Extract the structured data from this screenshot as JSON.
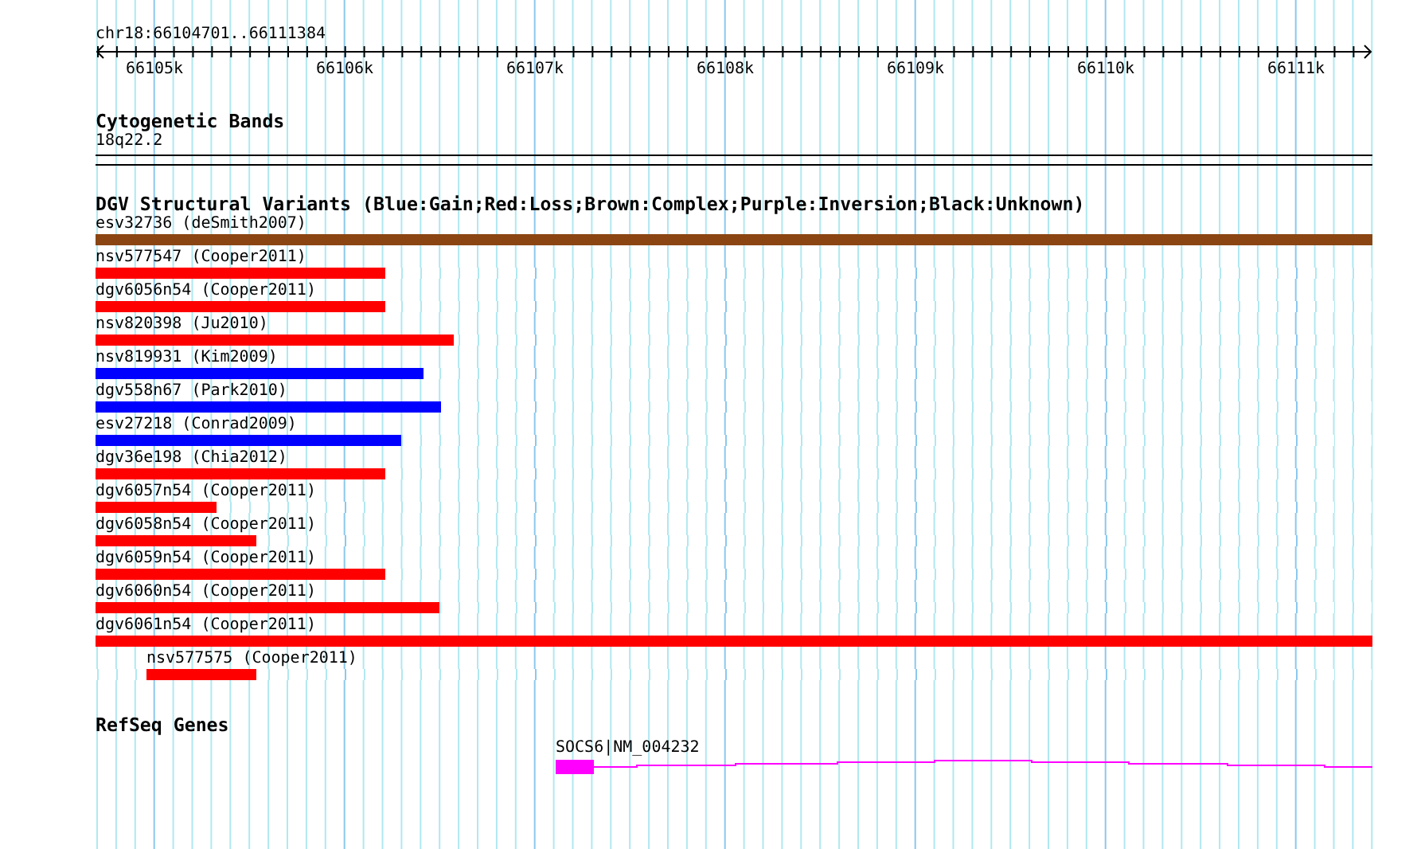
{
  "location": "chr18:66104701..66111384",
  "ruler": {
    "ticks": [
      "66105k",
      "66106k",
      "66107k",
      "66108k",
      "66109k",
      "66110k",
      "66111k"
    ]
  },
  "cytogenetic_bands": {
    "title": "Cytogenetic Bands",
    "band": "18q22.2"
  },
  "dgv": {
    "title": "DGV Structural Variants (Blue:Gain;Red:Loss;Brown:Complex;Purple:Inversion;Black:Unknown)",
    "variants": [
      {
        "label": "esv32736 (deSmith2007)",
        "color": "#8b4513",
        "level": 1,
        "kind": "flush"
      },
      {
        "label": "nsv577547 (Cooper2011)",
        "color": "#ff0000",
        "level": 0.227,
        "kind": "flush"
      },
      {
        "label": "dgv6056n54 (Cooper2011)",
        "color": "#ff0000",
        "level": 0.227,
        "kind": "flush"
      },
      {
        "label": "nsv820398 (Ju2010)",
        "color": "#ff0000",
        "level": 0.281,
        "kind": "flush"
      },
      {
        "label": "nsv819931 (Kim2009)",
        "color": "#0000ff",
        "level": 0.257,
        "kind": "flush"
      },
      {
        "label": "dgv558n67 (Park2010)",
        "color": "#0000ff",
        "level": 0.271,
        "kind": "flush"
      },
      {
        "label": "esv27218 (Conrad2009)",
        "color": "#0000ff",
        "level": 0.239,
        "kind": "flush"
      },
      {
        "label": "dgv36e198 (Chia2012)",
        "color": "#ff0000",
        "level": 0.227,
        "kind": "flush"
      },
      {
        "label": "dgv6057n54 (Cooper2011)",
        "color": "#ff0000",
        "level": 0.095,
        "kind": "flush"
      },
      {
        "label": "dgv6058n54 (Cooper2011)",
        "color": "#ff0000",
        "level": 0.126,
        "kind": "flush"
      },
      {
        "label": "dgv6059n54 (Cooper2011)",
        "color": "#ff0000",
        "level": 0.227,
        "kind": "flush"
      },
      {
        "label": "dgv6060n54 (Cooper2011)",
        "color": "#ff0000",
        "level": 0.269,
        "kind": "flush"
      },
      {
        "label": "dgv6061n54 (Cooper2011)",
        "color": "#ff0000",
        "level": 1,
        "kind": "flush"
      },
      {
        "label": "nsv577575 (Cooper2011)",
        "color": "#ff0000",
        "level": 0.086,
        "kind": "offset"
      }
    ]
  },
  "refseq": {
    "title": "RefSeq Genes",
    "genes": [
      {
        "label": "SOCS6|NM_004232"
      }
    ]
  }
}
